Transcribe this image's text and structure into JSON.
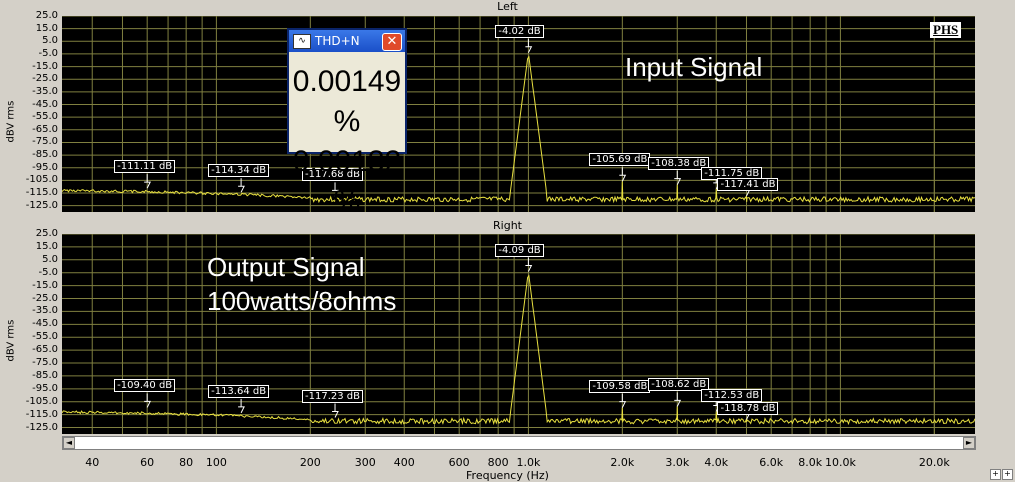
{
  "panels": [
    {
      "title": "Left",
      "ylabel": "dBV rms",
      "annotation": "Input Signal",
      "annotation2": "",
      "markers": [
        {
          "freq": 60,
          "db": -111.11,
          "label": "-111.11 dB"
        },
        {
          "freq": 120,
          "db": -114.34,
          "label": "-114.34 dB"
        },
        {
          "freq": 240,
          "db": -117.68,
          "label": "-117.68 dB"
        },
        {
          "freq": 1000,
          "db": -4.02,
          "label": "-4.02 dB"
        },
        {
          "freq": 2000,
          "db": -105.69,
          "label": "-105.69 dB"
        },
        {
          "freq": 3000,
          "db": -108.38,
          "label": "-108.38 dB"
        },
        {
          "freq": 4000,
          "db": -111.75,
          "label": "-111.75 dB"
        },
        {
          "freq": 5000,
          "db": -117.41,
          "label": "-117.41 dB"
        }
      ]
    },
    {
      "title": "Right",
      "ylabel": "dBV rms",
      "annotation": "Output Signal",
      "annotation2": "100watts/8ohms",
      "markers": [
        {
          "freq": 60,
          "db": -109.4,
          "label": "-109.40 dB"
        },
        {
          "freq": 120,
          "db": -113.64,
          "label": "-113.64 dB"
        },
        {
          "freq": 240,
          "db": -117.23,
          "label": "-117.23 dB"
        },
        {
          "freq": 1000,
          "db": -4.09,
          "label": "-4.09 dB"
        },
        {
          "freq": 2000,
          "db": -109.58,
          "label": "-109.58 dB"
        },
        {
          "freq": 3000,
          "db": -108.62,
          "label": "-108.62 dB"
        },
        {
          "freq": 4000,
          "db": -112.53,
          "label": "-112.53 dB"
        },
        {
          "freq": 5000,
          "db": -118.78,
          "label": "-118.78 dB"
        }
      ]
    }
  ],
  "yticks": [
    "25.0",
    "15.0",
    "5.0",
    "-5.0",
    "-15.0",
    "-25.0",
    "-35.0",
    "-45.0",
    "-55.0",
    "-65.0",
    "-75.0",
    "-85.0",
    "-95.0",
    "-105.0",
    "-115.0",
    "-125.0"
  ],
  "ytick_values": [
    25,
    15,
    5,
    -5,
    -15,
    -25,
    -35,
    -45,
    -55,
    -65,
    -75,
    -85,
    -95,
    -105,
    -115,
    -125
  ],
  "xticks": [
    {
      "label": "40",
      "value": 40
    },
    {
      "label": "60",
      "value": 60
    },
    {
      "label": "80",
      "value": 80
    },
    {
      "label": "100",
      "value": 100
    },
    {
      "label": "200",
      "value": 200
    },
    {
      "label": "300",
      "value": 300
    },
    {
      "label": "400",
      "value": 400
    },
    {
      "label": "600",
      "value": 600
    },
    {
      "label": "800",
      "value": 800
    },
    {
      "label": "1.0k",
      "value": 1000
    },
    {
      "label": "2.0k",
      "value": 2000
    },
    {
      "label": "3.0k",
      "value": 3000
    },
    {
      "label": "4.0k",
      "value": 4000
    },
    {
      "label": "6.0k",
      "value": 6000
    },
    {
      "label": "8.0k",
      "value": 8000
    },
    {
      "label": "10.0k",
      "value": 10000
    },
    {
      "label": "20.0k",
      "value": 20000
    }
  ],
  "xlabel": "Frequency (Hz)",
  "logo": "PHS",
  "thd_window": {
    "title": "THD+N",
    "close": "✕",
    "values": [
      "0.00149 %",
      "0.00132 %"
    ]
  },
  "scroll": {
    "left": "◄",
    "right": "►"
  },
  "zoom": [
    "+",
    "+"
  ],
  "colors": {
    "trace": "#e8e040",
    "grid": "#808040",
    "plot_bg": "#000000"
  }
}
